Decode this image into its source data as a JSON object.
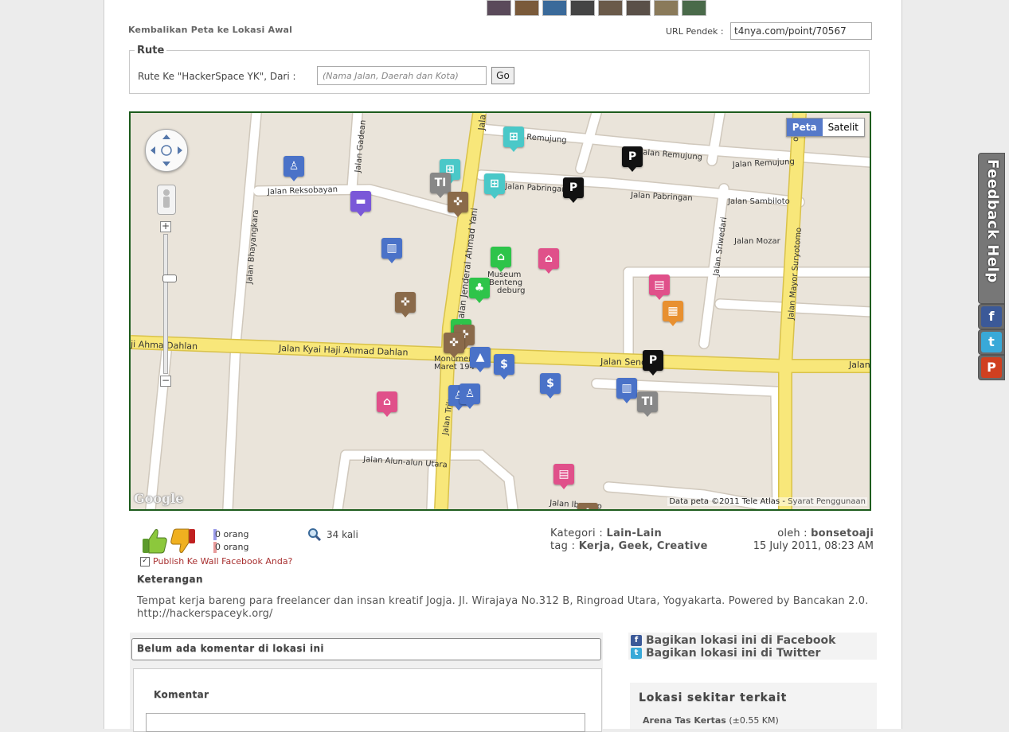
{
  "header": {
    "reset_map_link": "Kembalikan Peta ke Lokasi Awal",
    "short_url_label": "URL Pendek :",
    "short_url_value": "t4nya.com/point/70567"
  },
  "route": {
    "legend": "Rute",
    "label": "Rute Ke \"HackerSpace YK\", Dari :",
    "placeholder": "(Nama Jalan, Daerah dan Kota)",
    "go_label": "Go"
  },
  "map": {
    "map_type_options": [
      "Peta",
      "Satelit"
    ],
    "selected_type": "Peta",
    "attribution": "Data peta ©2011 Tele Atlas",
    "terms_link": "Syarat Penggunaan",
    "provider_logo": "Google",
    "zoom_in_label": "+",
    "zoom_out_label": "−",
    "road_labels": {
      "jalan_gadean": "Jalan Gadean",
      "jalan_reksobayan": "Jalan Reksobayan",
      "jalan_bhayangkara": "Jalan Bhayangkara",
      "jalan_ahmad_yani": "Jalan Jenderal Ahmad Yani",
      "jala": "Jala",
      "remujung_1": "Remujung",
      "jalan_remujung_1": "Jalan Remujung",
      "jalan_remujung_2": "Jalan Remujung",
      "jalan_pabringan_1": "Jalan Pabringan",
      "jalan_pabringan_2": "Jalan Pabringan",
      "jalan_sambiloto": "Jalan Sambiloto",
      "jalan_mozar": "Jalan Mozar",
      "jalan_sriwedari": "Jalan Sriwedari",
      "jalan_mayor_suryotomo": "Jalan Mayor Suryotomo",
      "jalan_kh_dahlan_left": "ji Ahma  Dahlan",
      "jalan_kh_dahlan": "Jalan Kyai Haji Ahmad Dahlan",
      "jalan_senopati": "Jalan Senopati",
      "jalan_right": "Jalan",
      "jalan_trikora": "Jalan Trikora",
      "jalan_alun": "Jalan Alun-alun Utara",
      "jalan_ibu": "Jalan Ibu  swo",
      "museum": "Museum",
      "benteng": "Benteng",
      "vredeburg": "deburg",
      "monumen": "Monumen",
      "maret": "Maret 194",
      "or": "or"
    },
    "marker_glyphs": {
      "parking": "P",
      "ti": "TI",
      "dollar": "$",
      "bank": "▥",
      "shop": "🛒",
      "movie": "▤"
    }
  },
  "stats": {
    "vote_up": "0 orang",
    "vote_down": "0 orang",
    "views": "34 kali",
    "publish_label": "Publish Ke Wall Facebook Anda?",
    "publish_checked": "✓",
    "category_label": "Kategori :",
    "category_value": "Lain-Lain",
    "tag_label": "tag :",
    "tag_value": "Kerja, Geek, Creative",
    "author_label": "oleh :",
    "author_value": "bonsetoaji",
    "date": "15 July 2011, 08:23 AM"
  },
  "description": {
    "heading": "Keterangan",
    "body": "Tempat kerja bareng para freelancer dan insan kreatif Jogja. Jl. Wirajaya No.312 B, Ringroad Utara, Yogyakarta. Powered by Bancakan 2.0. http://hackerspaceyk.org/"
  },
  "comments": {
    "title": "Belum ada komentar di lokasi ini",
    "form_label": "Komentar"
  },
  "share": {
    "facebook": "Bagikan lokasi ini di Facebook",
    "twitter": "Bagikan lokasi ini di Twitter",
    "fb_glyph": "f",
    "tw_glyph": "t"
  },
  "nearby": {
    "title": "Lokasi sekitar terkait",
    "items": [
      {
        "name": "Arena Tas Kertas",
        "distance": "(±0.55 KM)"
      }
    ]
  },
  "side_tabs": {
    "feedback": "Feedback  Help",
    "fb_glyph": "f",
    "tw_glyph": "t",
    "plurk_glyph": "P"
  },
  "colors": {
    "map_border": "#1d5c1d",
    "road_major": "#f8e77a",
    "road_minor": "#ffffff",
    "map_bg": "#eae4da",
    "peta_selected": "#5579c9",
    "link_red": "#a83030"
  }
}
